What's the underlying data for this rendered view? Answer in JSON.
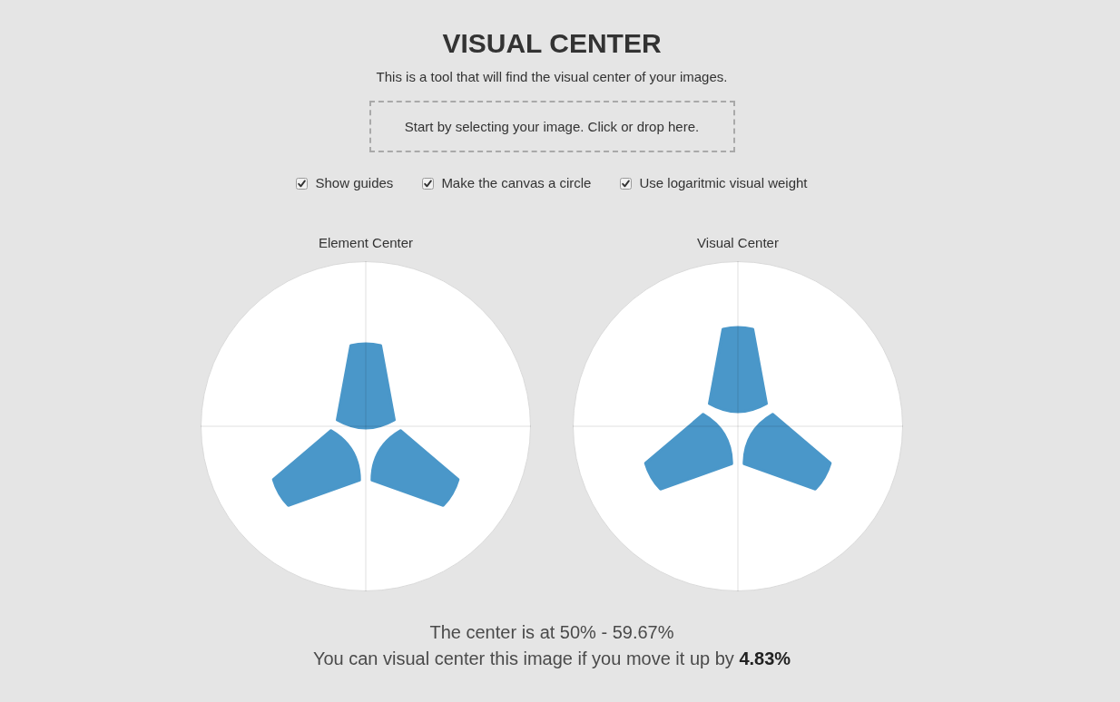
{
  "header": {
    "title": "VISUAL CENTER",
    "subtitle": "This is a tool that will find the visual center of your images."
  },
  "drop_zone": {
    "text": "Start by selecting your image. Click or drop here."
  },
  "options": [
    {
      "label": "Show guides",
      "checked": true
    },
    {
      "label": "Make the canvas a circle",
      "checked": true
    },
    {
      "label": "Use logaritmic visual weight",
      "checked": true
    }
  ],
  "previews": [
    {
      "kind": "element",
      "title": "Element Center"
    },
    {
      "kind": "visual",
      "title": "Visual Center"
    }
  ],
  "result": {
    "center_text": "The center is at 50% - 59.67%",
    "move_text": "You can visual center this image if you move it up by **4.83%**"
  }
}
